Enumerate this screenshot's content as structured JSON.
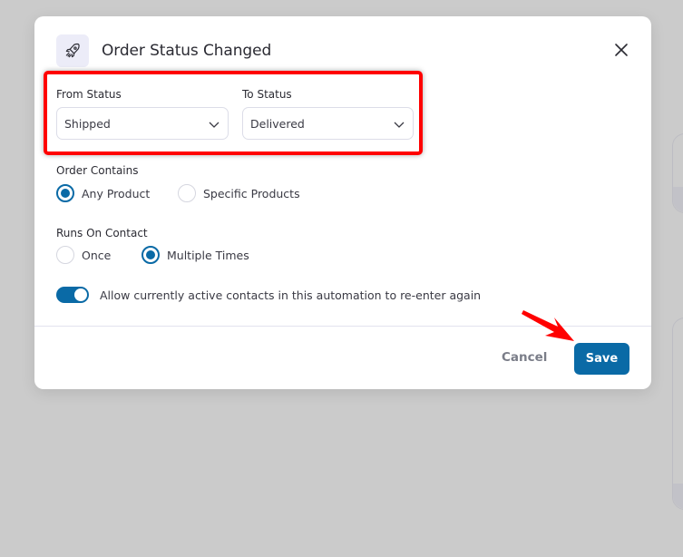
{
  "modal": {
    "title": "Order Status Changed",
    "icon": "rocket-icon",
    "close_icon": "close-icon"
  },
  "status": {
    "from_label": "From Status",
    "from_value": "Shipped",
    "to_label": "To Status",
    "to_value": "Delivered"
  },
  "order_contains": {
    "label": "Order Contains",
    "options": [
      {
        "label": "Any Product",
        "checked": true
      },
      {
        "label": "Specific Products",
        "checked": false
      }
    ]
  },
  "runs_on_contact": {
    "label": "Runs On Contact",
    "options": [
      {
        "label": "Once",
        "checked": false
      },
      {
        "label": "Multiple Times",
        "checked": true
      }
    ]
  },
  "reenter": {
    "label": "Allow currently active contacts in this automation to re-enter again",
    "enabled": true
  },
  "footer": {
    "cancel_label": "Cancel",
    "save_label": "Save"
  },
  "colors": {
    "accent": "#0a6aa6",
    "annotation": "#ff0000",
    "overlay": "#cbcbcb"
  }
}
